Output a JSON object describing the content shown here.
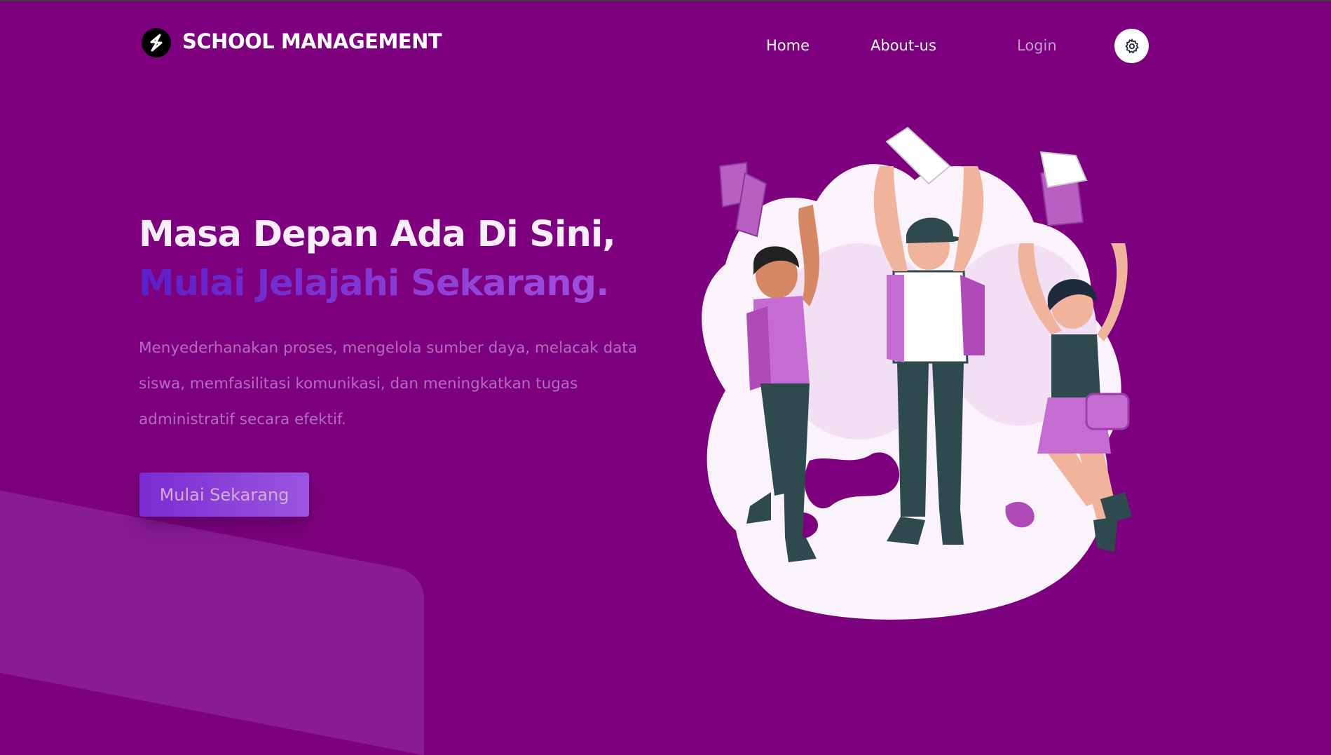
{
  "navbar": {
    "brand": "SCHOOL MANAGEMENT",
    "logo_icon": "lightning-bolt-icon",
    "links": [
      {
        "label": "Home"
      },
      {
        "label": "About-us"
      },
      {
        "label": "Login"
      }
    ],
    "theme_toggle_icon": "gear-icon"
  },
  "hero": {
    "title_line1": "Masa Depan Ada Di Sini,",
    "title_line2": "Mulai Jelajahi Sekarang.",
    "description": "Menyederhanakan proses, mengelola sumber daya, melacak data siswa, memfasilitasi komunikasi, dan meningkatkan tugas administratif secara efektif.",
    "cta_label": "Mulai Sekarang"
  },
  "illustration": {
    "subject": "students-jumping-illustration"
  },
  "colors": {
    "background": "#7d007e",
    "title_white": "#fbeefb",
    "title_gradient_start": "#5c1ec9",
    "title_gradient_end": "#a14fe0",
    "description_text": "#b46dbf",
    "login_link": "#c79ad0",
    "button_gradient_start": "#7a2cd2",
    "button_gradient_end": "#9a55e0"
  }
}
